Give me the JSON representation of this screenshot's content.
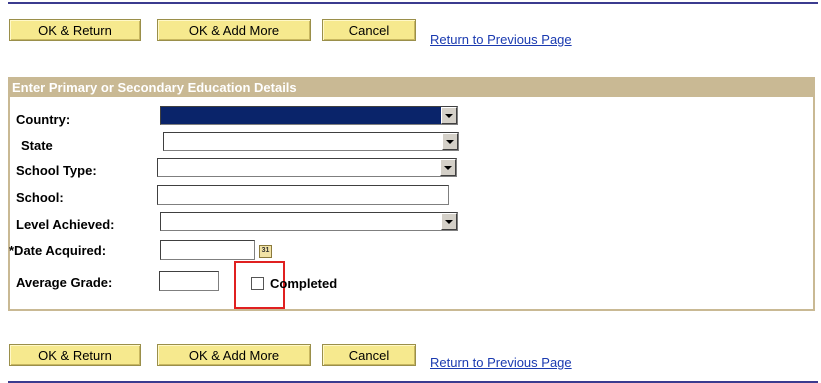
{
  "toolbar_top": {
    "ok_return": "OK & Return",
    "ok_add_more": "OK & Add More",
    "cancel": "Cancel",
    "return_link": "Return to Previous Page"
  },
  "toolbar_bottom": {
    "ok_return": "OK & Return",
    "ok_add_more": "OK & Add More",
    "cancel": "Cancel",
    "return_link": "Return to Previous Page"
  },
  "form": {
    "header": "Enter Primary or Secondary Education Details",
    "country_label": "Country:",
    "state_label": "State",
    "school_type_label": "School Type:",
    "school_label": "School:",
    "level_label": "Level Achieved:",
    "date_label": "*Date Acquired:",
    "grade_label": "Average Grade:",
    "completed_label": "Completed",
    "calendar_icon_text": "31"
  },
  "colors": {
    "button_bg": "#f6e98e",
    "header_bg": "#c9b994",
    "link": "#1a3ab0",
    "highlight": "#e02020"
  }
}
